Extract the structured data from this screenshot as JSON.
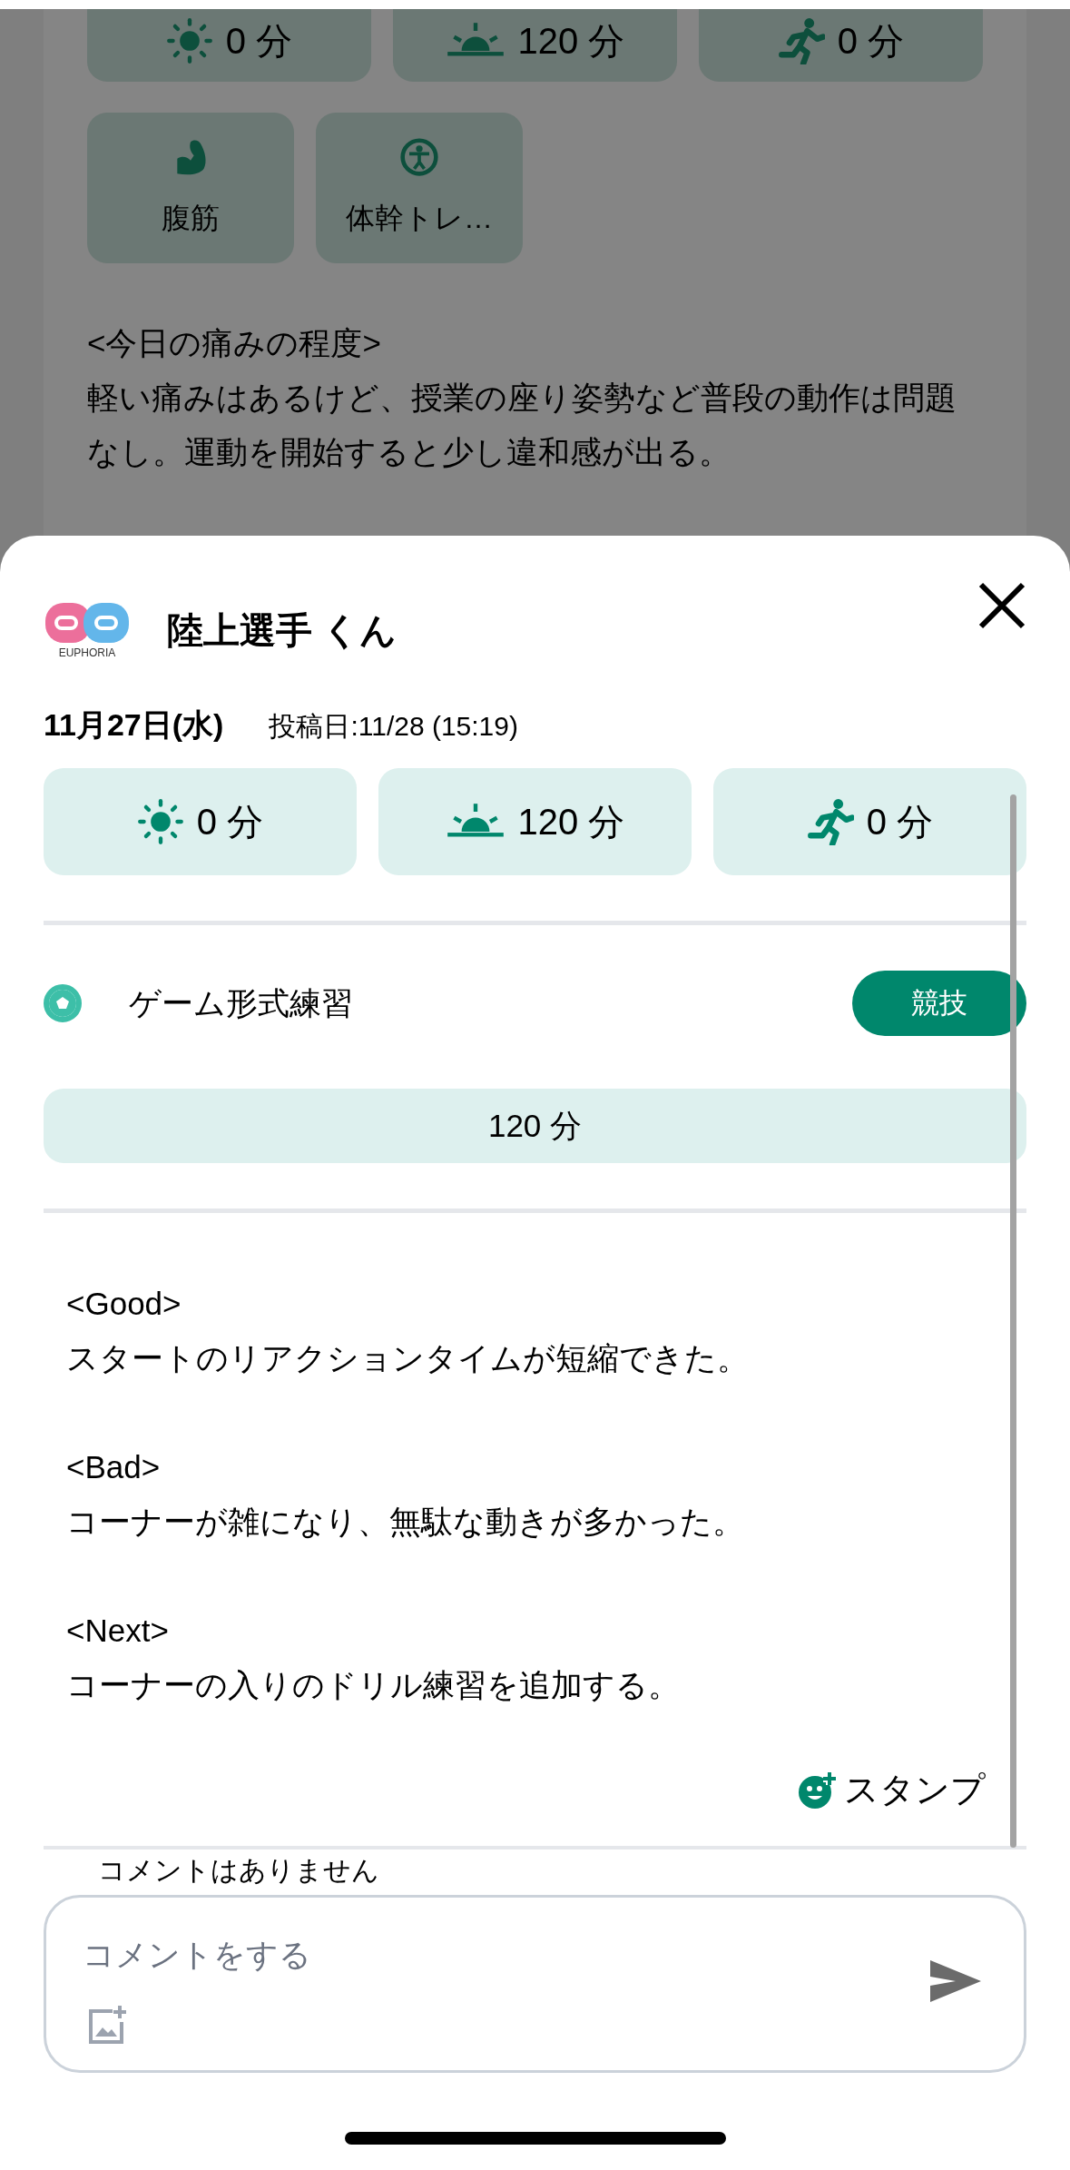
{
  "background": {
    "stats": [
      {
        "kind": "sun",
        "value": "0 分"
      },
      {
        "kind": "sunrise",
        "value": "120 分"
      },
      {
        "kind": "run",
        "value": "0 分"
      }
    ],
    "exercises": [
      {
        "kind": "muscle",
        "label": "腹筋"
      },
      {
        "kind": "core",
        "label": "体幹トレ…"
      }
    ],
    "note": {
      "heading": "<今日の痛みの程度>",
      "body": "軽い痛みはあるけど、授業の座り姿勢など普段の動作は問題なし。運動を開始すると少し違和感が出る。"
    }
  },
  "sheet": {
    "user": {
      "logo_text": "EUPHORIA",
      "name": "陸上選手 くん"
    },
    "date": "11月27日(水)",
    "posted": "投稿日:11/28 (15:19)",
    "stats": [
      {
        "kind": "sun",
        "value": "0 分"
      },
      {
        "kind": "sunrise",
        "value": "120 分"
      },
      {
        "kind": "run",
        "value": "0 分"
      }
    ],
    "activity": {
      "name": "ゲーム形式練習",
      "category": "競技",
      "duration": "120 分"
    },
    "report": [
      {
        "heading": "<Good>",
        "body": "スタートのリアクションタイムが短縮できた。"
      },
      {
        "heading": "<Bad>",
        "body": "コーナーが雑になり、無駄な動きが多かった。"
      },
      {
        "heading": "<Next>",
        "body": "コーナーの入りのドリル練習を追加する。"
      }
    ],
    "stamp_button": "スタンプ",
    "comments_empty": "コメントはありません",
    "comment_field": {
      "placeholder": "コメントをする"
    }
  }
}
